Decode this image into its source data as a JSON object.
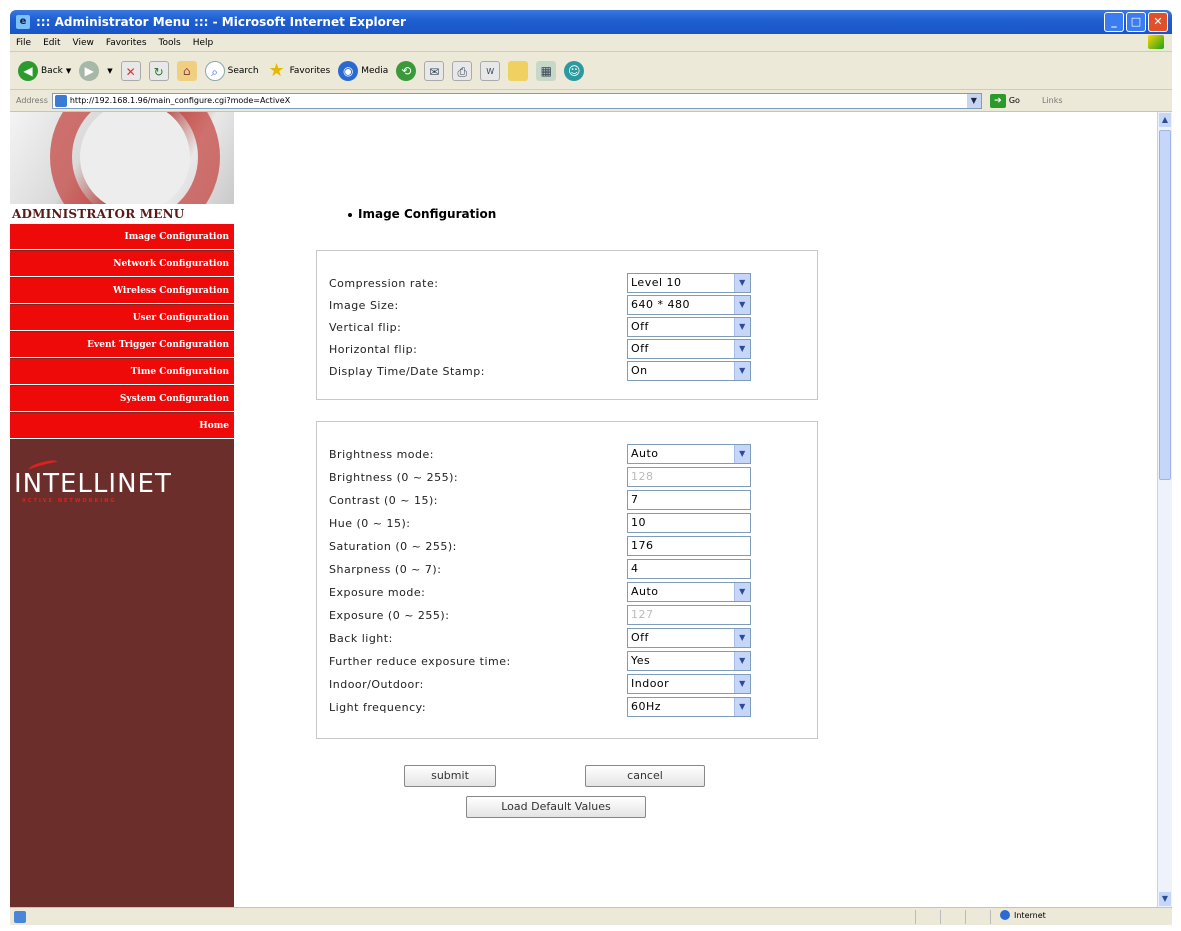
{
  "window": {
    "title": "::: Administrator Menu ::: - Microsoft Internet Explorer"
  },
  "menubar": [
    "File",
    "Edit",
    "View",
    "Favorites",
    "Tools",
    "Help"
  ],
  "toolbar": {
    "back": "Back",
    "search": "Search",
    "favorites": "Favorites",
    "media": "Media"
  },
  "address": {
    "label": "Address",
    "url": "http://192.168.1.96/main_configure.cgi?mode=ActiveX",
    "go": "Go",
    "links": "Links"
  },
  "sidebar": {
    "header": "ADMINISTRATOR MENU",
    "items": [
      {
        "label": "Image Configuration"
      },
      {
        "label": "Network Configuration"
      },
      {
        "label": "Wireless Configuration"
      },
      {
        "label": "User Configuration"
      },
      {
        "label": "Event Trigger Configuration"
      },
      {
        "label": "Time Configuration"
      },
      {
        "label": "System Configuration"
      },
      {
        "label": "Home"
      }
    ],
    "logo_text": "INTELLINET",
    "logo_tagline": "ACTIVE NETWORKING"
  },
  "main": {
    "heading": "Image Configuration",
    "panel1": [
      {
        "label": "Compression rate:",
        "value": "Level 10",
        "type": "select"
      },
      {
        "label": "Image Size:",
        "value": "640 * 480",
        "type": "select"
      },
      {
        "label": "Vertical flip:",
        "value": "Off",
        "type": "select"
      },
      {
        "label": "Horizontal flip:",
        "value": "Off",
        "type": "select"
      },
      {
        "label": "Display Time/Date Stamp:",
        "value": "On",
        "type": "select"
      }
    ],
    "panel2": [
      {
        "label": "Brightness mode:",
        "value": "Auto",
        "type": "select"
      },
      {
        "label": "Brightness (0 ~ 255):",
        "value": "128",
        "type": "text-disabled"
      },
      {
        "label": "Contrast (0 ~ 15):",
        "value": "7",
        "type": "text"
      },
      {
        "label": "Hue (0 ~ 15):",
        "value": "10",
        "type": "text"
      },
      {
        "label": "Saturation (0 ~ 255):",
        "value": "176",
        "type": "text"
      },
      {
        "label": "Sharpness (0 ~ 7):",
        "value": "4",
        "type": "text"
      },
      {
        "label": "Exposure mode:",
        "value": "Auto",
        "type": "select"
      },
      {
        "label": "Exposure (0 ~ 255):",
        "value": "127",
        "type": "text-disabled"
      },
      {
        "label": "Back light:",
        "value": "Off",
        "type": "select"
      },
      {
        "label": "Further reduce exposure time:",
        "value": "Yes",
        "type": "select"
      },
      {
        "label": "Indoor/Outdoor:",
        "value": "Indoor",
        "type": "select"
      },
      {
        "label": "Light frequency:",
        "value": "60Hz",
        "type": "select"
      }
    ],
    "buttons": {
      "submit": "submit",
      "cancel": "cancel",
      "defaults": "Load Default Values"
    }
  },
  "status": {
    "zone": "Internet"
  }
}
